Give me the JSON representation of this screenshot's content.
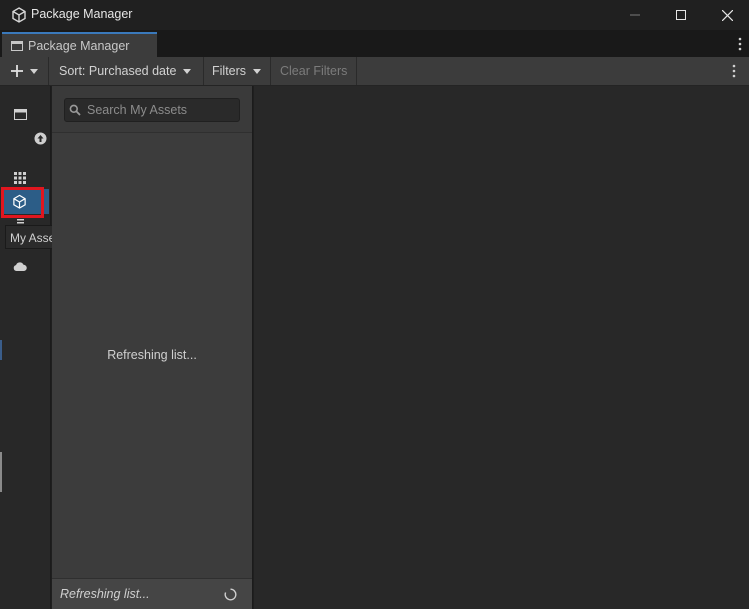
{
  "window": {
    "title": "Package Manager",
    "icons": {
      "app": "unity-cube-icon",
      "minimize": "minimize-icon",
      "maximize": "maximize-icon",
      "close": "close-icon"
    }
  },
  "tab": {
    "label": "Package Manager",
    "icon": "window-icon"
  },
  "toolbar": {
    "add_icon": "plus-icon",
    "sort_label": "Sort: Purchased date",
    "filters_label": "Filters",
    "clear_filters_label": "Clear Filters"
  },
  "sidebar": {
    "items": [
      {
        "name": "in-project",
        "icon": "window-icon"
      },
      {
        "name": "updates",
        "icon": "arrow-up-circle-icon"
      },
      {
        "name": "unity-registry",
        "icon": "grid-icon"
      },
      {
        "name": "my-assets",
        "icon": "cube-icon",
        "selected": true
      },
      {
        "name": "built-in",
        "icon": "stack-icon"
      },
      {
        "name": "services",
        "icon": "cloud-icon"
      }
    ],
    "tooltip": "My Assets"
  },
  "list": {
    "search_placeholder": "Search My Assets",
    "center_message": "Refreshing list...",
    "status_text": "Refreshing list..."
  },
  "colors": {
    "accent_selected": "#2c5d87",
    "tab_accent": "#3a79bb",
    "highlight": "#e0161f"
  }
}
